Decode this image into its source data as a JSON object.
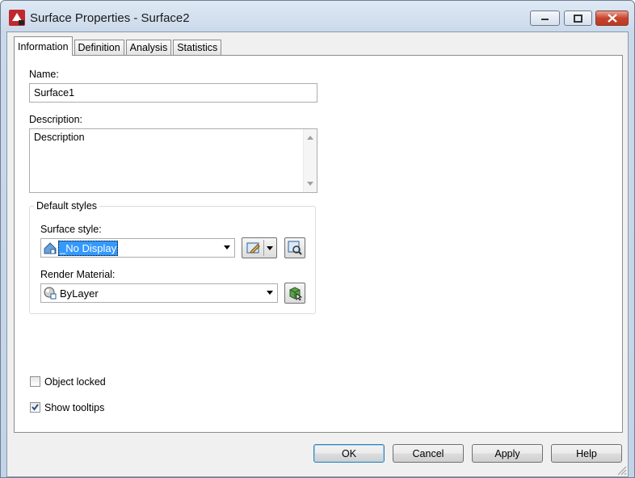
{
  "window": {
    "title": "Surface Properties - Surface2",
    "controls": {
      "minimize_icon": "minimize-icon",
      "maximize_icon": "maximize-icon",
      "close_icon": "close-icon"
    }
  },
  "tabs": [
    {
      "label": "Information",
      "active": true
    },
    {
      "label": "Definition",
      "active": false
    },
    {
      "label": "Analysis",
      "active": false
    },
    {
      "label": "Statistics",
      "active": false
    }
  ],
  "information": {
    "name_label": "Name:",
    "name_value": "Surface1",
    "description_label": "Description:",
    "description_value": "Description",
    "default_styles": {
      "title": "Default styles",
      "surface_style_label": "Surface style:",
      "surface_style_value": "_No Display",
      "render_material_label": "Render Material:",
      "render_material_value": "ByLayer"
    },
    "object_locked": {
      "label": "Object locked",
      "checked": false
    },
    "show_tooltips": {
      "label": "Show tooltips",
      "checked": true
    }
  },
  "buttons": {
    "ok": "OK",
    "cancel": "Cancel",
    "apply": "Apply",
    "help": "Help"
  },
  "colors": {
    "selection": "#3399ff",
    "close_button": "#c8432d",
    "default_button_border": "#3c7fb1"
  }
}
